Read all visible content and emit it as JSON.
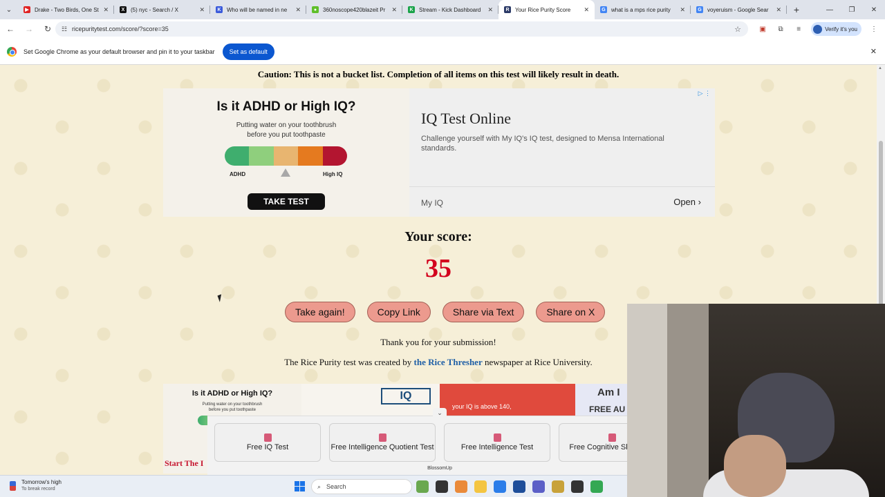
{
  "browser": {
    "tabs": [
      {
        "title": "Drake - Two Birds, One St",
        "favicon_color": "#e02424",
        "favicon_glyph": "▶",
        "active": false
      },
      {
        "title": "(5) nyc - Search / X",
        "favicon_color": "#111111",
        "favicon_glyph": "X",
        "active": false
      },
      {
        "title": "Who will be named in ne",
        "favicon_color": "#3b5bdb",
        "favicon_glyph": "K",
        "active": false
      },
      {
        "title": "360noscope420blazeit Pr",
        "favicon_color": "#5fbf2a",
        "favicon_glyph": "●",
        "active": false
      },
      {
        "title": "Stream - Kick Dashboard",
        "favicon_color": "#1aa34a",
        "favicon_glyph": "K",
        "active": false
      },
      {
        "title": "Your Rice Purity Score",
        "favicon_color": "#2b3a67",
        "favicon_glyph": "R",
        "active": true
      },
      {
        "title": "what is a mps rice purity",
        "favicon_color": "#4285f4",
        "favicon_glyph": "G",
        "active": false
      },
      {
        "title": "voyeruism - Google Sear",
        "favicon_color": "#4285f4",
        "favicon_glyph": "G",
        "active": false
      }
    ],
    "url": "ricepuritytest.com/score/?score=35",
    "profile_label": "Verify it's you",
    "infobar": {
      "message": "Set Google Chrome as your default browser and pin it to your taskbar",
      "button": "Set as default"
    }
  },
  "page": {
    "caution": "Caution: This is not a bucket list. Completion of all items on this test will likely result in death.",
    "ad_top": {
      "left": {
        "question": "Is it ADHD or High IQ?",
        "subtitle_lines": [
          "Putting water on your toothbrush",
          "before you put toothpaste"
        ],
        "scale_left": "ADHD",
        "scale_right": "High IQ",
        "cta": "TAKE TEST",
        "scale_colors": [
          "#3fae6e",
          "#8fcf7d",
          "#e8b570",
          "#e57a1f",
          "#b31530"
        ]
      },
      "right": {
        "headline": "IQ Test Online",
        "description": "Challenge yourself with My IQ's IQ test, designed to Mensa International standards.",
        "advertiser": "My IQ",
        "open_label": "Open"
      }
    },
    "score_label": "Your score:",
    "score_value": "35",
    "buttons": {
      "take_again": "Take again!",
      "copy_link": "Copy Link",
      "share_text": "Share via Text",
      "share_x": "Share on X"
    },
    "thanks": "Thank you for your submission!",
    "credit": {
      "prefix": "The Rice Purity test was created by ",
      "link": "the Rice Thresher",
      "suffix": " newspaper at Rice University."
    },
    "ad_bottom": {
      "card1_question": "Is it ADHD or High IQ?",
      "card1_sub": [
        "Putting water on your toothbrush",
        "before you put toothpaste"
      ],
      "card2_badge": "IQ",
      "card3_text": "your IQ is above 140,",
      "card4_line1": "Am I",
      "card4_line2": "FREE AU",
      "start_text": "Start The I"
    },
    "recommendations": {
      "items": [
        "Free IQ Test",
        "Free Intelligence Quotient Test",
        "Free Intelligence Test",
        "Free Cognitive Skills Test"
      ],
      "brand": "BlossomUp"
    }
  },
  "taskbar": {
    "weather_line1": "Tomorrow's high",
    "weather_line2": "To break record",
    "search_placeholder": "Search",
    "app_colors": [
      "#6aa84f",
      "#333333",
      "#ea8a3a",
      "#f4c542",
      "#2b7de9",
      "#1e4e9a",
      "#5b5fc7",
      "#c8a23a",
      "#333333",
      "#34a853"
    ]
  }
}
